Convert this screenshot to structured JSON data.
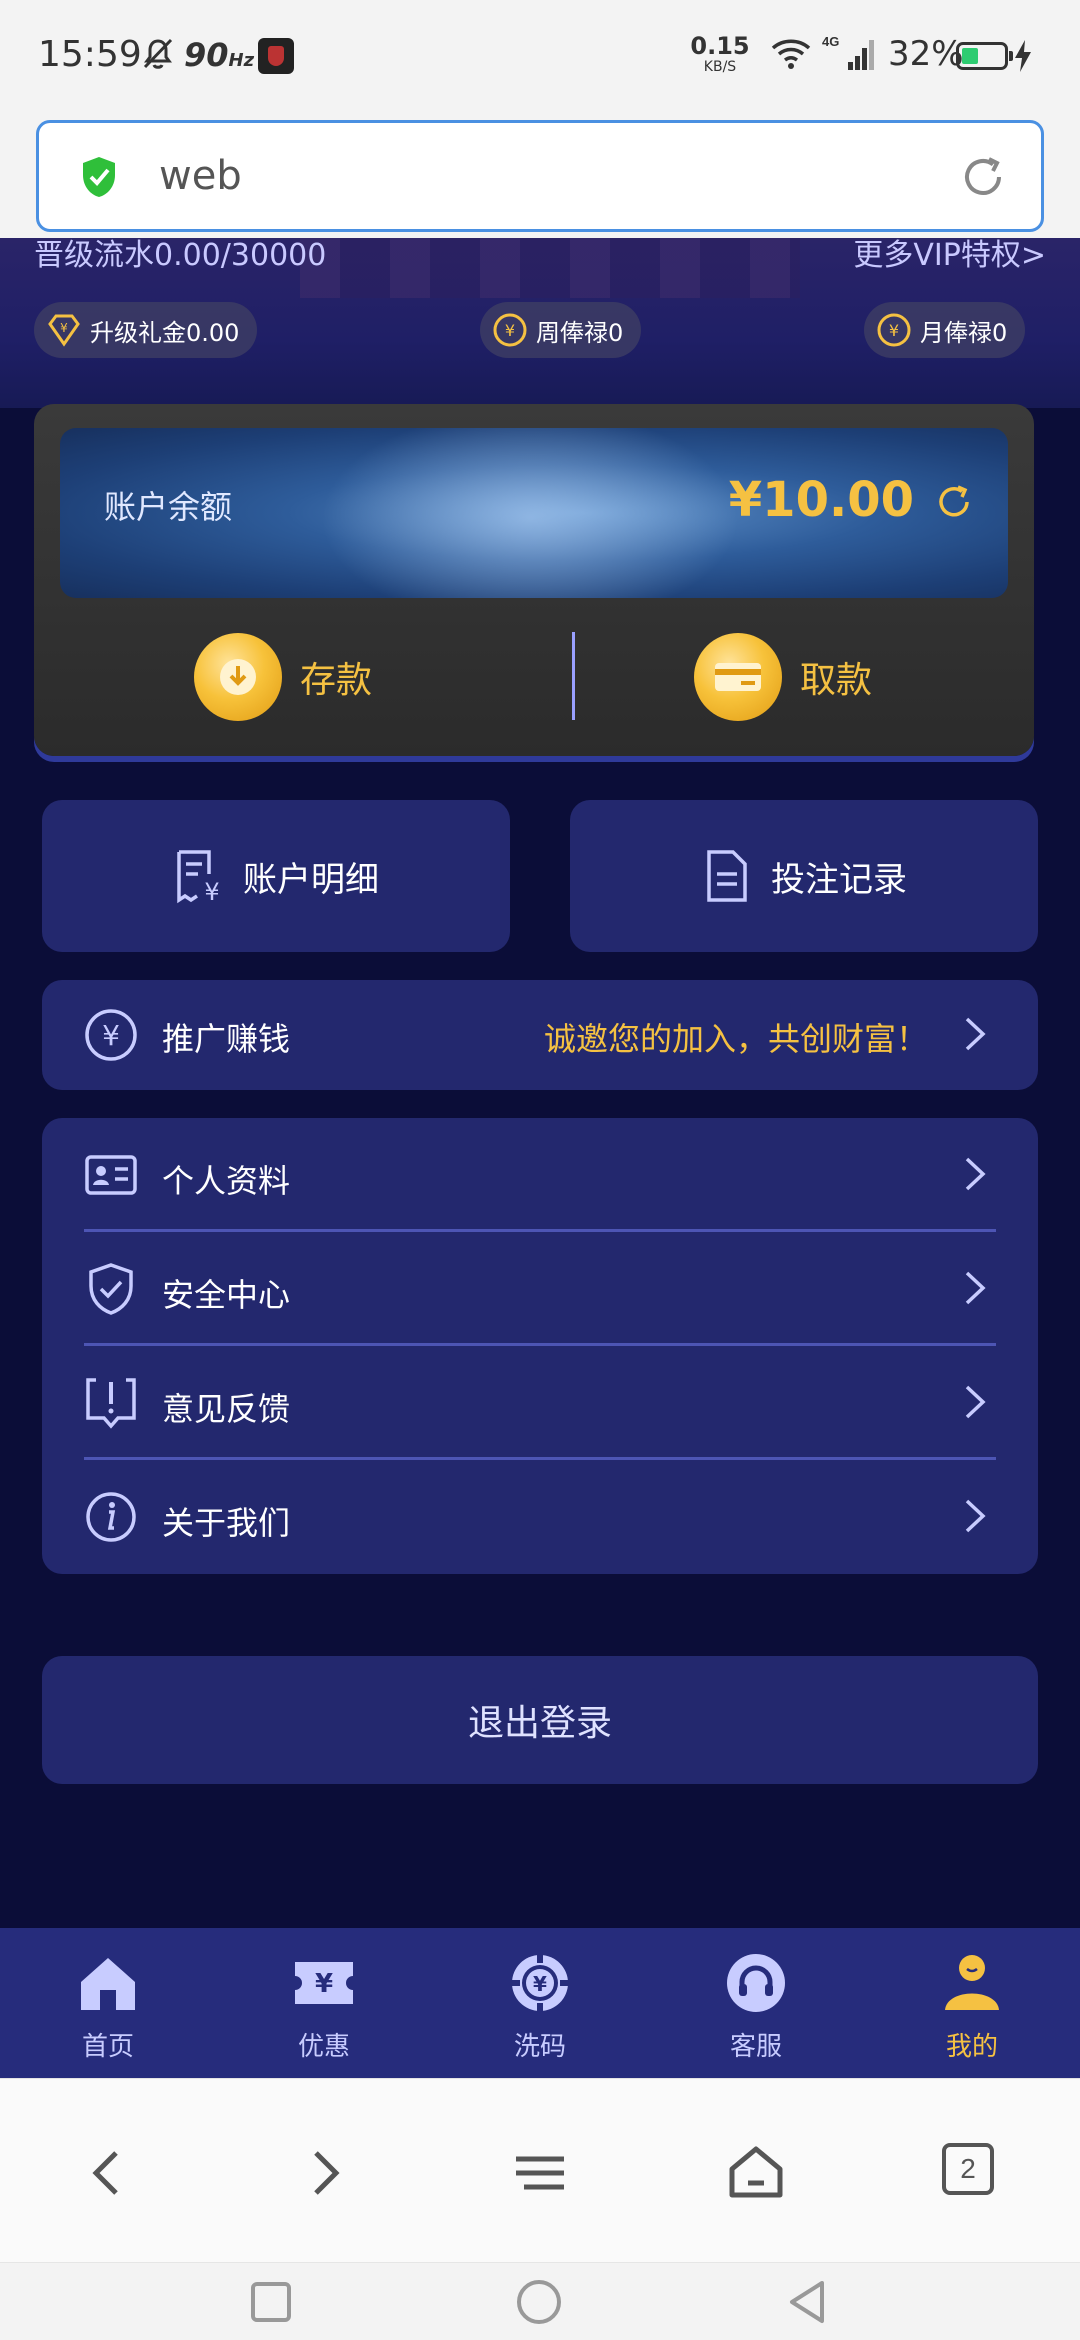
{
  "status_bar": {
    "time": "15:59",
    "refresh_rate": "90",
    "refresh_unit": "Hz",
    "net_speed": "0.15",
    "net_unit": "KB/S",
    "network": "4G",
    "battery": "32%"
  },
  "url_bar": {
    "text": "web",
    "shield_color": "#2fbf3a"
  },
  "vip": {
    "progress": "晋级流水0.00/30000",
    "more": "更多VIP特权>",
    "chips": [
      {
        "label": "升级礼金0.00"
      },
      {
        "label": "周俸禄0"
      },
      {
        "label": "月俸禄0"
      }
    ]
  },
  "wallet": {
    "label": "账户余额",
    "amount": "¥10.00",
    "deposit": "存款",
    "withdraw": "取款"
  },
  "tiles": [
    {
      "label": "账户明细",
      "icon": "receipt-yen-icon"
    },
    {
      "label": "投注记录",
      "icon": "document-icon"
    }
  ],
  "promo": {
    "label": "推广赚钱",
    "slogan": "诚邀您的加入，共创财富！",
    "icon": "yen-circle-icon"
  },
  "menu": [
    {
      "label": "个人资料",
      "icon": "id-card-icon"
    },
    {
      "label": "安全中心",
      "icon": "shield-check-icon"
    },
    {
      "label": "意见反馈",
      "icon": "feedback-icon"
    },
    {
      "label": "关于我们",
      "icon": "info-icon"
    }
  ],
  "logout": "退出登录",
  "tabbar": [
    {
      "label": "首页",
      "icon": "home-icon",
      "active": false
    },
    {
      "label": "优惠",
      "icon": "ticket-icon",
      "active": false
    },
    {
      "label": "洗码",
      "icon": "chip-icon",
      "active": false
    },
    {
      "label": "客服",
      "icon": "headset-icon",
      "active": false
    },
    {
      "label": "我的",
      "icon": "user-icon",
      "active": true
    }
  ],
  "browser_nav": {
    "tab_count": "2"
  },
  "colors": {
    "background": "#0b0d38",
    "card": "#23286e",
    "accent_gold": "#f5c142",
    "tabbar": "#262c7c"
  }
}
